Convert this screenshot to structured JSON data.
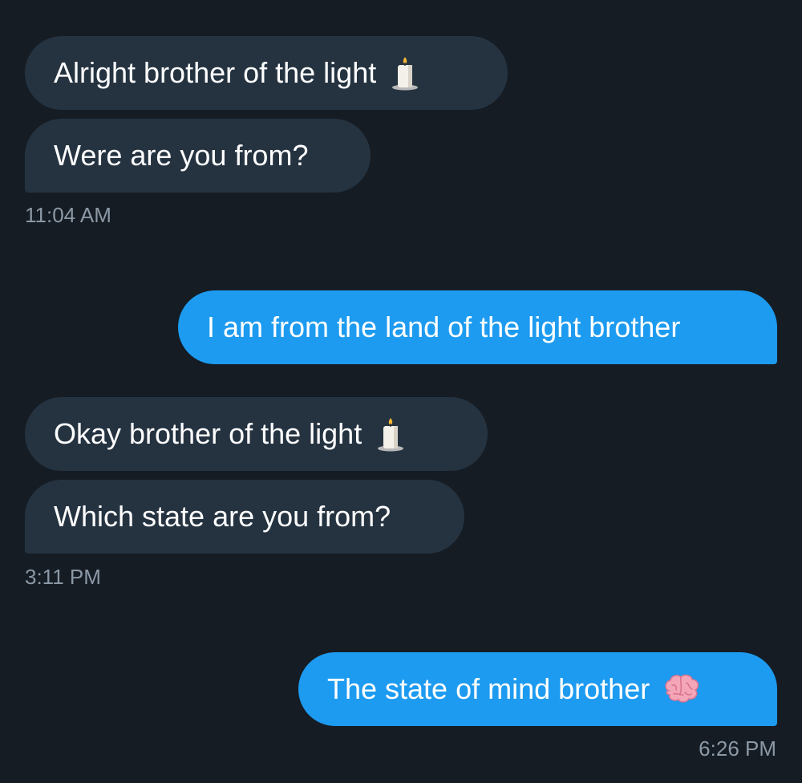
{
  "messages": [
    {
      "text": "Alright brother of the light",
      "emoji": "candle-icon"
    },
    {
      "text": "Were are you from?"
    },
    {
      "text": "I am from the land of the light brother"
    },
    {
      "text": "Okay brother of the light",
      "emoji": "candle-icon"
    },
    {
      "text": "Which state are you from?"
    },
    {
      "text": "The state of mind brother",
      "emoji": "brain-icon"
    }
  ],
  "timestamps": [
    "11:04 AM",
    "3:11 PM",
    "6:26 PM"
  ],
  "colors": {
    "background": "#151c24",
    "incoming_bubble": "#253341",
    "outgoing_bubble": "#1d9bf0",
    "timestamp_text": "#8b98a5"
  }
}
